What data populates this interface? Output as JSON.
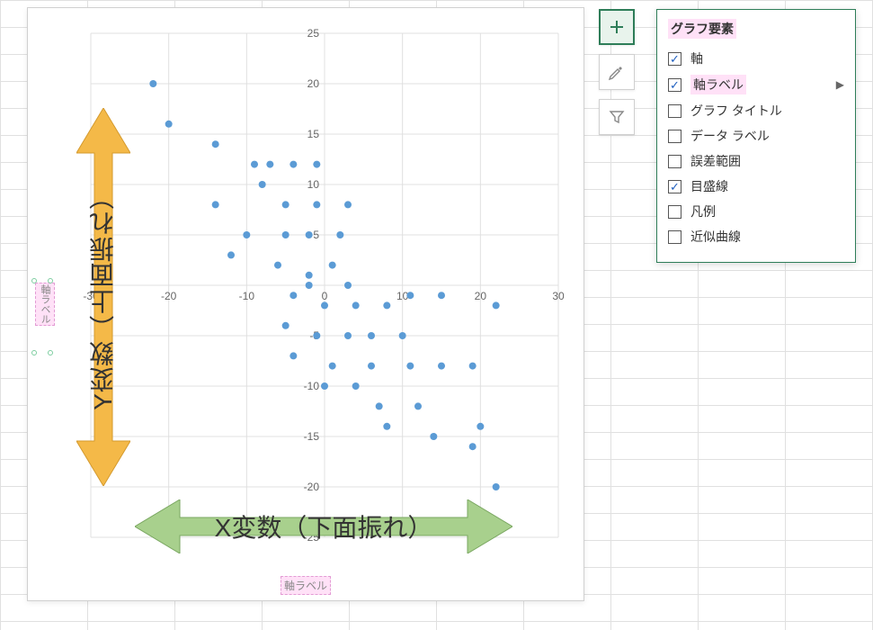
{
  "flyout": {
    "title": "グラフ要素",
    "items": [
      {
        "label": "軸",
        "checked": true,
        "highlight": false,
        "submenu": false
      },
      {
        "label": "軸ラベル",
        "checked": true,
        "highlight": true,
        "submenu": true
      },
      {
        "label": "グラフ タイトル",
        "checked": false,
        "highlight": false,
        "submenu": false
      },
      {
        "label": "データ ラベル",
        "checked": false,
        "highlight": false,
        "submenu": false
      },
      {
        "label": "誤差範囲",
        "checked": false,
        "highlight": false,
        "submenu": false
      },
      {
        "label": "目盛線",
        "checked": true,
        "highlight": false,
        "submenu": false
      },
      {
        "label": "凡例",
        "checked": false,
        "highlight": false,
        "submenu": false
      },
      {
        "label": "近似曲線",
        "checked": false,
        "highlight": false,
        "submenu": false
      }
    ]
  },
  "axis_label_x": "軸ラベル",
  "axis_label_y": "軸ラベル",
  "overlay": {
    "x_label": "X変数（下面振れ）",
    "y_label": "Y変数（上面振れ）",
    "x_color": "#a8d08d",
    "y_color": "#f4b948"
  },
  "chart_data": {
    "type": "scatter",
    "title": "",
    "xlabel": "軸ラベル",
    "ylabel": "軸ラベル",
    "xlim": [
      -30,
      30
    ],
    "ylim": [
      -25,
      25
    ],
    "xticks": [
      -30,
      -20,
      -10,
      0,
      10,
      20,
      30
    ],
    "yticks": [
      -25,
      -20,
      -15,
      -10,
      -5,
      0,
      5,
      10,
      15,
      20,
      25
    ],
    "grid": true,
    "series": [
      {
        "name": "points",
        "color": "#5b9bd5",
        "points": [
          [
            -22,
            20
          ],
          [
            -20,
            16
          ],
          [
            -14,
            14
          ],
          [
            -9,
            12
          ],
          [
            -7,
            12
          ],
          [
            -4,
            12
          ],
          [
            -1,
            12
          ],
          [
            -14,
            8
          ],
          [
            -8,
            10
          ],
          [
            -5,
            8
          ],
          [
            -1,
            8
          ],
          [
            3,
            8
          ],
          [
            -10,
            5
          ],
          [
            -5,
            5
          ],
          [
            -2,
            5
          ],
          [
            2,
            5
          ],
          [
            -12,
            3
          ],
          [
            -6,
            2
          ],
          [
            -2,
            1
          ],
          [
            1,
            2
          ],
          [
            3,
            0
          ],
          [
            -2,
            0
          ],
          [
            -4,
            -1
          ],
          [
            0,
            -2
          ],
          [
            4,
            -2
          ],
          [
            8,
            -2
          ],
          [
            11,
            -1
          ],
          [
            15,
            -1
          ],
          [
            22,
            -2
          ],
          [
            -5,
            -4
          ],
          [
            -1,
            -5
          ],
          [
            3,
            -5
          ],
          [
            6,
            -5
          ],
          [
            10,
            -5
          ],
          [
            -4,
            -7
          ],
          [
            1,
            -8
          ],
          [
            6,
            -8
          ],
          [
            11,
            -8
          ],
          [
            15,
            -8
          ],
          [
            19,
            -8
          ],
          [
            0,
            -10
          ],
          [
            4,
            -10
          ],
          [
            7,
            -12
          ],
          [
            12,
            -12
          ],
          [
            8,
            -14
          ],
          [
            20,
            -14
          ],
          [
            14,
            -15
          ],
          [
            19,
            -16
          ],
          [
            22,
            -20
          ]
        ]
      }
    ]
  }
}
